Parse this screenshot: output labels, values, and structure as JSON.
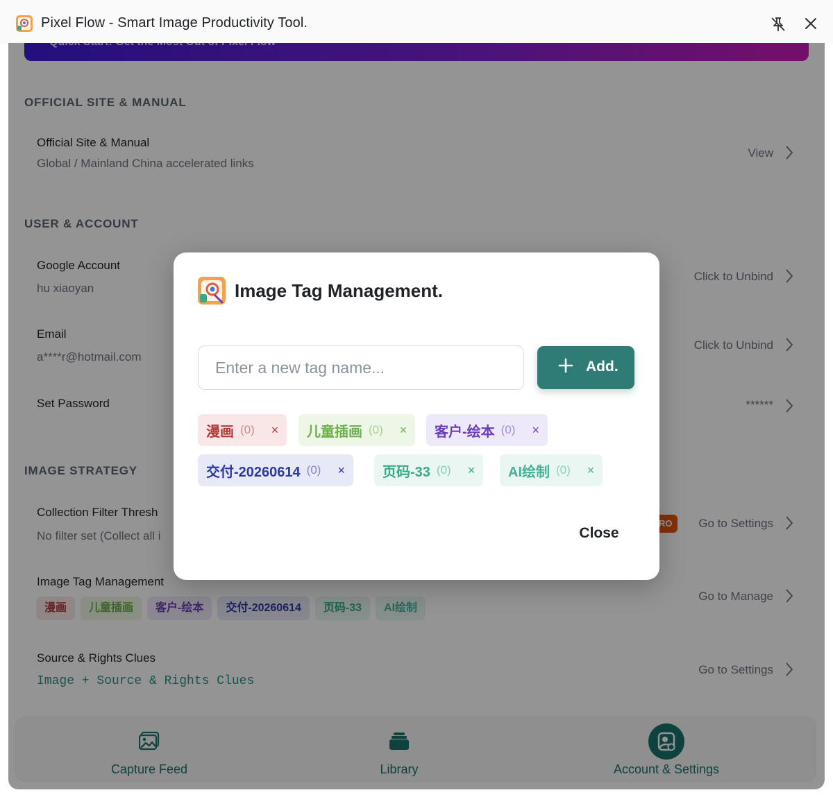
{
  "window": {
    "title": "Pixel Flow - Smart Image Productivity Tool."
  },
  "banner": {
    "text": "Quick Start: Get the Most Out of Pixel Flow"
  },
  "sections": {
    "official": {
      "heading": "OFFICIAL SITE & MANUAL",
      "row": {
        "title": "Official Site & Manual",
        "subtitle": "Global / Mainland China accelerated links",
        "action": "View"
      }
    },
    "account": {
      "heading": "USER & ACCOUNT",
      "google": {
        "title": "Google Account",
        "subtitle": "hu xiaoyan",
        "action": "Click to Unbind"
      },
      "email": {
        "title": "Email",
        "subtitle": "a****r@hotmail.com",
        "action": "Click to Unbind"
      },
      "password": {
        "title": "Set Password",
        "action": "******"
      }
    },
    "strategy": {
      "heading": "IMAGE STRATEGY",
      "filter": {
        "title": "Collection Filter Thresh",
        "subtitle": "No filter set (Collect all i",
        "badge": "RO",
        "action": "Go to Settings"
      },
      "tags": {
        "title": "Image Tag Management",
        "action": "Go to Manage"
      },
      "source": {
        "title": "Source & Rights Clues",
        "subtitle": "Image + Source & Rights Clues",
        "action": "Go to Settings"
      }
    }
  },
  "tags": [
    {
      "name": "漫画",
      "count": "(0)",
      "color": "#b23a3a",
      "bg": "#f8e7e6"
    },
    {
      "name": "儿童插画",
      "count": "(0)",
      "color": "#6bb04a",
      "bg": "#eef7e7"
    },
    {
      "name": "客户-绘本",
      "count": "(0)",
      "color": "#6a3eb5",
      "bg": "#eee9f8"
    },
    {
      "name": "交付-20260614",
      "count": "(0)",
      "color": "#2e3b9e",
      "bg": "#e7e9f7"
    },
    {
      "name": "页码-33",
      "count": "(0)",
      "color": "#3aa98a",
      "bg": "#e9f6f1"
    },
    {
      "name": "AI绘制",
      "count": "(0)",
      "color": "#43b398",
      "bg": "#e9f6f2"
    }
  ],
  "bottom_nav": [
    {
      "label": "Capture Feed",
      "icon": "image-icon"
    },
    {
      "label": "Library",
      "icon": "stack-icon"
    },
    {
      "label": "Account & Settings",
      "icon": "account-settings-icon"
    }
  ],
  "modal": {
    "title": "Image Tag Management.",
    "input_placeholder": "Enter a new tag name...",
    "input_value": "",
    "add_label": "Add.",
    "close_label": "Close",
    "remove_symbol": "×"
  },
  "colors": {
    "accent": "#2f7b75",
    "pro_badge": "#e2560e"
  }
}
